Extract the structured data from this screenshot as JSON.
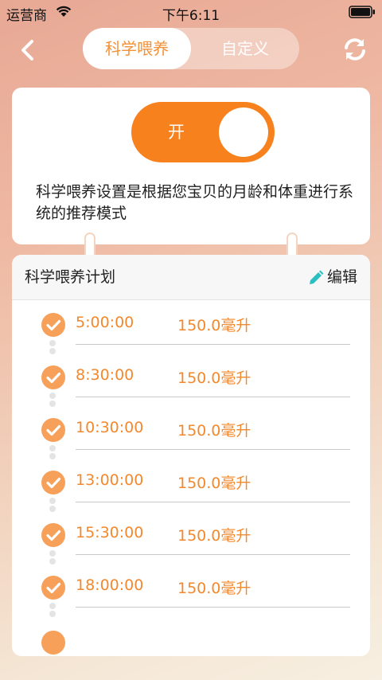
{
  "status": {
    "carrier": "运营商",
    "time": "下午6:11"
  },
  "nav": {
    "tabs": [
      {
        "label": "科学喂养",
        "active": true
      },
      {
        "label": "自定义",
        "active": false
      }
    ]
  },
  "toggle": {
    "label": "开",
    "on": true
  },
  "description": "科学喂养设置是根据您宝贝的月龄和体重进行系统的推荐模式",
  "plan": {
    "title": "科学喂养计划",
    "edit_label": "编辑",
    "rows": [
      {
        "time": "5:00:00",
        "amount": "150.0毫升"
      },
      {
        "time": "8:30:00",
        "amount": "150.0毫升"
      },
      {
        "time": "10:30:00",
        "amount": "150.0毫升"
      },
      {
        "time": "13:00:00",
        "amount": "150.0毫升"
      },
      {
        "time": "15:30:00",
        "amount": "150.0毫升"
      },
      {
        "time": "18:00:00",
        "amount": "150.0毫升"
      }
    ]
  },
  "colors": {
    "accent": "#f7811c",
    "accent_text": "#f2892e",
    "check": "#f6a05a",
    "edit_icon": "#2bbfc2"
  }
}
